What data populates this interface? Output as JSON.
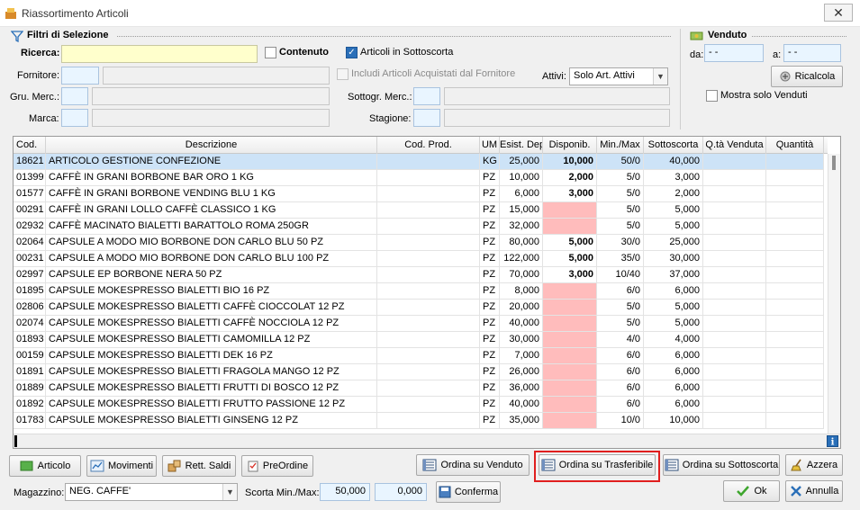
{
  "window": {
    "title": "Riassortimento Articoli",
    "close": "✕"
  },
  "filters": {
    "title": "Filtri di Selezione",
    "ricerca_label": "Ricerca:",
    "ricerca_value": "",
    "contenuto_label": "Contenuto",
    "sottoscorta_label": "Articoli in Sottoscorta",
    "fornitore_label": "Fornitore:",
    "includi_label": "Includi Articoli Acquistati dal Fornitore",
    "attivi_label": "Attivi:",
    "attivi_value": "Solo Art. Attivi",
    "gru_merc_label": "Gru. Merc.:",
    "sottogr_label": "Sottogr. Merc.:",
    "marca_label": "Marca:",
    "stagione_label": "Stagione:"
  },
  "venduto": {
    "title": "Venduto",
    "da_label": "da:",
    "da_value": "- -",
    "a_label": "a:",
    "a_value": "- -",
    "ricalcola_label": "Ricalcola",
    "mostra_label": "Mostra solo Venduti"
  },
  "table": {
    "columns": [
      "Cod.",
      "Descrizione",
      "Cod. Prod.",
      "UM",
      "Esist. Dep.",
      "Disponib.",
      "Min./Max",
      "Sottoscorta",
      "Q.tà Venduta",
      "Quantità"
    ],
    "rows": [
      {
        "cod": "18621",
        "desc": "ARTICOLO GESTIONE CONFEZIONE",
        "codprod": "",
        "um": "KG",
        "esist": "25,000",
        "disp": "10,000",
        "minmax": "50/0",
        "sotto": "40,000",
        "qv": "",
        "qta": ""
      },
      {
        "cod": "01399",
        "desc": "CAFFÈ IN GRANI BORBONE BAR ORO 1 KG",
        "codprod": "",
        "um": "PZ",
        "esist": "10,000",
        "disp": "2,000",
        "minmax": "5/0",
        "sotto": "3,000",
        "qv": "",
        "qta": ""
      },
      {
        "cod": "01577",
        "desc": "CAFFÈ IN GRANI BORBONE VENDING BLU 1 KG",
        "codprod": "",
        "um": "PZ",
        "esist": "6,000",
        "disp": "3,000",
        "minmax": "5/0",
        "sotto": "2,000",
        "qv": "",
        "qta": ""
      },
      {
        "cod": "00291",
        "desc": "CAFFÈ IN GRANI LOLLO CAFFÈ CLASSICO 1 KG",
        "codprod": "",
        "um": "PZ",
        "esist": "15,000",
        "disp": "",
        "minmax": "5/0",
        "sotto": "5,000",
        "qv": "",
        "qta": ""
      },
      {
        "cod": "02932",
        "desc": "CAFFÈ MACINATO BIALETTI BARATTOLO ROMA 250GR",
        "codprod": "",
        "um": "PZ",
        "esist": "32,000",
        "disp": "",
        "minmax": "5/0",
        "sotto": "5,000",
        "qv": "",
        "qta": ""
      },
      {
        "cod": "02064",
        "desc": "CAPSULE A MODO MIO BORBONE DON CARLO  BLU  50 PZ",
        "codprod": "",
        "um": "PZ",
        "esist": "80,000",
        "disp": "5,000",
        "minmax": "30/0",
        "sotto": "25,000",
        "qv": "",
        "qta": ""
      },
      {
        "cod": "00231",
        "desc": "CAPSULE A MODO MIO BORBONE DON CARLO  BLU 100 PZ",
        "codprod": "",
        "um": "PZ",
        "esist": "122,000",
        "disp": "5,000",
        "minmax": "35/0",
        "sotto": "30,000",
        "qv": "",
        "qta": ""
      },
      {
        "cod": "02997",
        "desc": "CAPSULE EP BORBONE  NERA  50 PZ",
        "codprod": "",
        "um": "PZ",
        "esist": "70,000",
        "disp": "3,000",
        "minmax": "10/40",
        "sotto": "37,000",
        "qv": "",
        "qta": ""
      },
      {
        "cod": "01895",
        "desc": "CAPSULE MOKESPRESSO BIALETTI BIO 16 PZ",
        "codprod": "",
        "um": "PZ",
        "esist": "8,000",
        "disp": "",
        "minmax": "6/0",
        "sotto": "6,000",
        "qv": "",
        "qta": ""
      },
      {
        "cod": "02806",
        "desc": "CAPSULE MOKESPRESSO BIALETTI CAFFÈ CIOCCOLAT 12 PZ",
        "codprod": "",
        "um": "PZ",
        "esist": "20,000",
        "disp": "",
        "minmax": "5/0",
        "sotto": "5,000",
        "qv": "",
        "qta": ""
      },
      {
        "cod": "02074",
        "desc": "CAPSULE MOKESPRESSO BIALETTI CAFFÈ NOCCIOLA 12 PZ",
        "codprod": "",
        "um": "PZ",
        "esist": "40,000",
        "disp": "",
        "minmax": "5/0",
        "sotto": "5,000",
        "qv": "",
        "qta": ""
      },
      {
        "cod": "01893",
        "desc": "CAPSULE MOKESPRESSO BIALETTI CAMOMILLA 12 PZ",
        "codprod": "",
        "um": "PZ",
        "esist": "30,000",
        "disp": "",
        "minmax": "4/0",
        "sotto": "4,000",
        "qv": "",
        "qta": ""
      },
      {
        "cod": "00159",
        "desc": "CAPSULE MOKESPRESSO BIALETTI DEK 16 PZ",
        "codprod": "",
        "um": "PZ",
        "esist": "7,000",
        "disp": "",
        "minmax": "6/0",
        "sotto": "6,000",
        "qv": "",
        "qta": ""
      },
      {
        "cod": "01891",
        "desc": "CAPSULE MOKESPRESSO BIALETTI FRAGOLA MANGO 12 PZ",
        "codprod": "",
        "um": "PZ",
        "esist": "26,000",
        "disp": "",
        "minmax": "6/0",
        "sotto": "6,000",
        "qv": "",
        "qta": ""
      },
      {
        "cod": "01889",
        "desc": "CAPSULE MOKESPRESSO BIALETTI FRUTTI DI BOSCO 12 PZ",
        "codprod": "",
        "um": "PZ",
        "esist": "36,000",
        "disp": "",
        "minmax": "6/0",
        "sotto": "6,000",
        "qv": "",
        "qta": ""
      },
      {
        "cod": "01892",
        "desc": "CAPSULE MOKESPRESSO BIALETTI FRUTTO PASSIONE 12 PZ",
        "codprod": "",
        "um": "PZ",
        "esist": "40,000",
        "disp": "",
        "minmax": "6/0",
        "sotto": "6,000",
        "qv": "",
        "qta": ""
      },
      {
        "cod": "01783",
        "desc": "CAPSULE MOKESPRESSO BIALETTI GINSENG 12 PZ",
        "codprod": "",
        "um": "PZ",
        "esist": "35,000",
        "disp": "",
        "minmax": "10/0",
        "sotto": "10,000",
        "qv": "",
        "qta": ""
      }
    ]
  },
  "bottom": {
    "articolo": "Articolo",
    "movimenti": "Movimenti",
    "rett_saldi": "Rett. Saldi",
    "preordine": "PreOrdine",
    "ordina_venduto": "Ordina su Venduto",
    "ordina_trasferibile": "Ordina su Trasferibile",
    "ordina_sottoscorta": "Ordina su Sottoscorta",
    "azzera": "Azzera",
    "magazzino_label": "Magazzino:",
    "magazzino_value": "NEG. CAFFE'",
    "scorta_label": "Scorta Min./Max:",
    "scorta_min": "50,000",
    "scorta_max": "0,000",
    "conferma": "Conferma",
    "ok": "Ok",
    "annulla": "Annulla"
  },
  "colors": {
    "accent": "#2a6fb8",
    "selection": "#cde3f7",
    "sottoscorta_empty": "#ffbcbc",
    "highlight": "#e01f1f"
  }
}
